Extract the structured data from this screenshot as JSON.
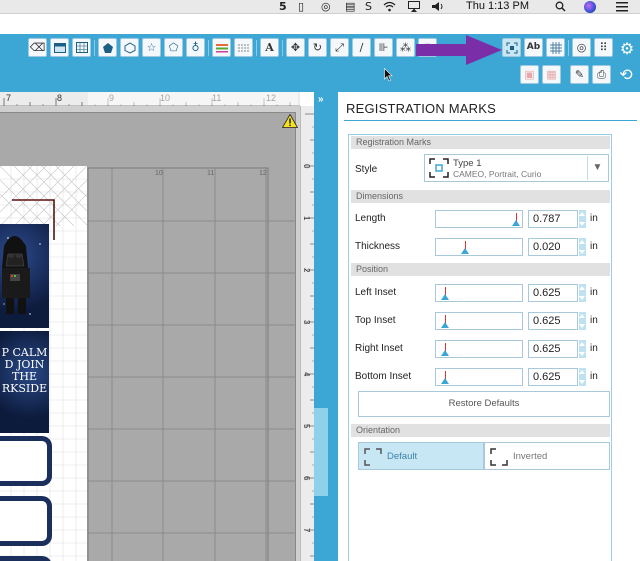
{
  "menubar": {
    "time": "Thu 1:13 PM",
    "icons": [
      "5",
      "▯",
      "◎",
      "▤",
      "S",
      "wifi-icon",
      "airplay-icon",
      "volume-icon",
      "search-icon",
      "siri-icon",
      "menu-icon"
    ]
  },
  "toolbar": {
    "row1_icons": [
      "eraser-icon",
      "rectangle-fill-icon",
      "grid-fill-icon",
      "pentagon-icon",
      "hexagon-icon",
      "star-icon",
      "cut-shape-icon",
      "draw-icon",
      "lines-icon",
      "lines-thin-icon",
      "text-icon",
      "transform-icon",
      "rotate-icon",
      "scale-icon",
      "pencil-icon",
      "align-icon",
      "replicate-icon",
      "nest-icon",
      "registration-marks-icon",
      "ab-text-icon",
      "dot-grid-icon",
      "offset-icon",
      "tracking-icon",
      "settings-icon"
    ],
    "row2_icons": [
      "page-icon",
      "media-icon",
      "eraser2-icon",
      "send-icon",
      "refresh-icon"
    ]
  },
  "canvas": {
    "ruler_top_labels": [
      "7",
      "8",
      "9",
      "10",
      "11",
      "12"
    ],
    "mat_labels": [
      "10",
      "11",
      "12"
    ],
    "vruler_labels": [
      "0",
      "1",
      "2",
      "3",
      "4",
      "5",
      "6",
      "7"
    ],
    "card_text": "P CALM\nD JOIN\nTHE\nRKSIDE"
  },
  "panel": {
    "title": "REGISTRATION MARKS",
    "sections": {
      "marks": "Registration Marks",
      "dimensions": "Dimensions",
      "position": "Position",
      "orientation": "Orientation"
    },
    "style": {
      "label": "Style",
      "type_line": "Type 1",
      "machines_line": "CAMEO, Portrait, Curio",
      "caret": "▼"
    },
    "fields": [
      {
        "label": "Length",
        "value": "0.787",
        "unit": "in",
        "fraction": 0.98
      },
      {
        "label": "Thickness",
        "value": "0.020",
        "unit": "in",
        "fraction": 0.32
      },
      {
        "label": "Left Inset",
        "value": "0.625",
        "unit": "in",
        "fraction": 0.07
      },
      {
        "label": "Top Inset",
        "value": "0.625",
        "unit": "in",
        "fraction": 0.07
      },
      {
        "label": "Right Inset",
        "value": "0.625",
        "unit": "in",
        "fraction": 0.07
      },
      {
        "label": "Bottom Inset",
        "value": "0.625",
        "unit": "in",
        "fraction": 0.07
      }
    ],
    "restore_label": "Restore Defaults",
    "orientation": {
      "default_label": "Default",
      "inverted_label": "Inverted",
      "selected": "Default"
    }
  },
  "colors": {
    "accent": "#3ca7d4",
    "annotation_arrow": "#7a2fa8",
    "marker_red": "#dd3333"
  }
}
